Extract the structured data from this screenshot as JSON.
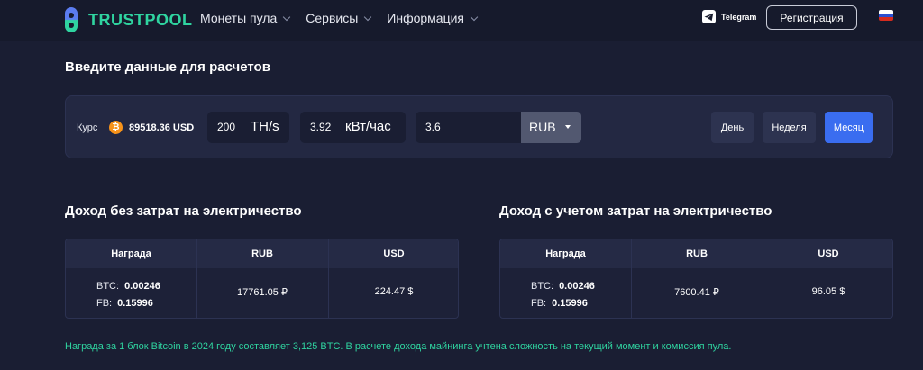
{
  "brand": {
    "part1": "TRUST",
    "part2": "POOL"
  },
  "nav": [
    {
      "label": "Монеты пула"
    },
    {
      "label": "Сервисы"
    },
    {
      "label": "Информация"
    }
  ],
  "header": {
    "telegram_label": "Telegram",
    "register_label": "Регистрация"
  },
  "calc": {
    "title": "Введите данные для расчетов",
    "rate_label": "Курс",
    "rate_value": "89518.36 USD",
    "hashrate_value": "200",
    "hashrate_unit": "TH/s",
    "power_value": "3.92",
    "power_unit": "кВт/час",
    "price_value": "3.6",
    "currency": "RUB",
    "periods": [
      "День",
      "Неделя",
      "Месяц"
    ],
    "active_period": "Месяц"
  },
  "income": [
    {
      "title": "Доход без затрат на электричество",
      "headers": [
        "Награда",
        "RUB",
        "USD"
      ],
      "btc_label": "BTC:",
      "btc_value": "0.00246",
      "fb_label": "FB:",
      "fb_value": "0.15996",
      "rub": "17761.05 ₽",
      "usd": "224.47 $"
    },
    {
      "title": "Доход с учетом затрат на электричество",
      "headers": [
        "Награда",
        "RUB",
        "USD"
      ],
      "btc_label": "BTC:",
      "btc_value": "0.00246",
      "fb_label": "FB:",
      "fb_value": "0.15996",
      "rub": "7600.41 ₽",
      "usd": "96.05 $"
    }
  ],
  "note": "Награда за 1 блок Bitcoin в 2024 году составляет 3,125 BTC. В расчете дохода майнинга учтена сложность на текущий момент и комиссия пула.",
  "colors": {
    "accent": "#2fd4a0",
    "primary_button": "#3a6df0",
    "background": "#1a1e33"
  }
}
